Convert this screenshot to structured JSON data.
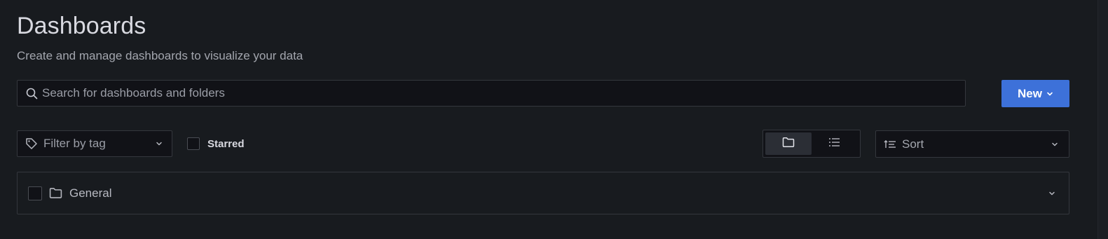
{
  "header": {
    "title": "Dashboards",
    "subtitle": "Create and manage dashboards to visualize your data"
  },
  "search": {
    "placeholder": "Search for dashboards and folders",
    "value": "",
    "icon": "search-icon"
  },
  "actions": {
    "new_label": "New",
    "new_icon": "chevron-down-icon",
    "accent_color": "#3d71d9"
  },
  "filters": {
    "tag_filter_label": "Filter by tag",
    "tag_icon": "tag-icon",
    "starred_label": "Starred",
    "starred_checked": false
  },
  "view_toggle": {
    "options": [
      {
        "name": "folder-view",
        "icon": "folder-icon",
        "active": true
      },
      {
        "name": "list-view",
        "icon": "list-icon",
        "active": false
      }
    ]
  },
  "sort": {
    "label": "Sort",
    "icon": "sort-ascending-icon"
  },
  "folders": [
    {
      "label": "General",
      "checked": false,
      "icon": "folder-icon",
      "expand_icon": "chevron-down-icon"
    }
  ]
}
